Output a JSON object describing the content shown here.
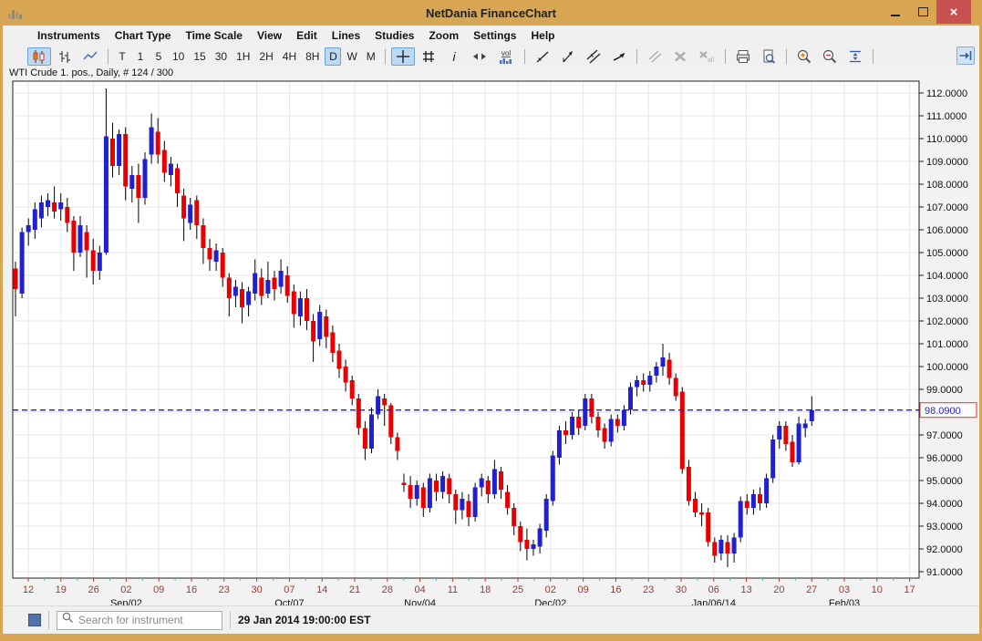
{
  "window": {
    "title": "NetDania FinanceChart",
    "icon": "chart-icon",
    "buttons": [
      {
        "name": "minimize"
      },
      {
        "name": "maximize"
      },
      {
        "name": "close",
        "glyph": "×"
      }
    ]
  },
  "menu": {
    "items": [
      {
        "label": "Instruments"
      },
      {
        "label": "Chart Type"
      },
      {
        "label": "Time Scale"
      },
      {
        "label": "View"
      },
      {
        "label": "Edit"
      },
      {
        "label": "Lines"
      },
      {
        "label": "Studies"
      },
      {
        "label": "Zoom"
      },
      {
        "label": "Settings"
      },
      {
        "label": "Help"
      }
    ]
  },
  "toolbar": {
    "items": [
      {
        "type": "icon",
        "name": "candlestick-chart",
        "selected": true
      },
      {
        "type": "icon",
        "name": "ohlc-bars"
      },
      {
        "type": "icon",
        "name": "line-chart"
      },
      {
        "type": "sep"
      },
      {
        "type": "text",
        "label": "T",
        "name": "timescale-tick"
      },
      {
        "type": "text",
        "label": "1",
        "name": "timescale-1m"
      },
      {
        "type": "text",
        "label": "5",
        "name": "timescale-5m"
      },
      {
        "type": "text",
        "label": "10",
        "name": "timescale-10m"
      },
      {
        "type": "text",
        "label": "15",
        "name": "timescale-15m"
      },
      {
        "type": "text",
        "label": "30",
        "name": "timescale-30m"
      },
      {
        "type": "text",
        "label": "1H",
        "name": "timescale-1h"
      },
      {
        "type": "text",
        "label": "2H",
        "name": "timescale-2h"
      },
      {
        "type": "text",
        "label": "4H",
        "name": "timescale-4h"
      },
      {
        "type": "text",
        "label": "8H",
        "name": "timescale-8h"
      },
      {
        "type": "text",
        "label": "D",
        "name": "timescale-daily",
        "selected": true
      },
      {
        "type": "text",
        "label": "W",
        "name": "timescale-weekly"
      },
      {
        "type": "text",
        "label": "M",
        "name": "timescale-monthly"
      },
      {
        "type": "sep"
      },
      {
        "type": "icon",
        "name": "crosshair",
        "selected": true
      },
      {
        "type": "icon",
        "name": "grid"
      },
      {
        "type": "icon",
        "name": "info"
      },
      {
        "type": "icon",
        "name": "scroll-horizontal"
      },
      {
        "type": "icon",
        "name": "volume"
      },
      {
        "type": "sep"
      },
      {
        "type": "icon",
        "name": "trendline"
      },
      {
        "type": "icon",
        "name": "trendline-angle"
      },
      {
        "type": "icon",
        "name": "parallel-lines"
      },
      {
        "type": "icon",
        "name": "draw-arrow"
      },
      {
        "type": "sep"
      },
      {
        "type": "icon",
        "name": "parallel-lines-disabled",
        "disabled": true
      },
      {
        "type": "icon",
        "name": "delete-line",
        "disabled": true
      },
      {
        "type": "icon",
        "name": "delete-all-lines",
        "disabled": true
      },
      {
        "type": "sep"
      },
      {
        "type": "icon",
        "name": "print"
      },
      {
        "type": "icon",
        "name": "print-preview"
      },
      {
        "type": "sep"
      },
      {
        "type": "icon",
        "name": "zoom-in"
      },
      {
        "type": "icon",
        "name": "zoom-out"
      },
      {
        "type": "icon",
        "name": "fit-vertical"
      },
      {
        "type": "sep"
      }
    ],
    "pin_button": {
      "name": "collapse-pin"
    }
  },
  "chart": {
    "label": "WTI Crude 1. pos., Daily, # 124 / 300",
    "price_line": {
      "value": "98.0900",
      "price": 98.09
    }
  },
  "chart_data": {
    "type": "candlestick",
    "title": "WTI Crude 1. pos., Daily",
    "instrument": "WTI Crude 1. pos.",
    "timeframe": "Daily",
    "visible_bars": 124,
    "total_bars": 300,
    "last_price": 98.09,
    "ylim": [
      90.7,
      112.5
    ],
    "y_ticks": [
      "112.0000",
      "111.0000",
      "110.0000",
      "109.0000",
      "108.0000",
      "107.0000",
      "106.0000",
      "105.0000",
      "104.0000",
      "103.0000",
      "102.0000",
      "101.0000",
      "100.0000",
      "99.0000",
      "98.0000",
      "97.0000",
      "96.0000",
      "95.0000",
      "94.0000",
      "93.0000",
      "92.0000",
      "91.0000"
    ],
    "x_week_labels": [
      "12",
      "19",
      "26",
      "02",
      "09",
      "16",
      "23",
      "30",
      "07",
      "14",
      "21",
      "28",
      "04",
      "11",
      "18",
      "25",
      "02",
      "09",
      "16",
      "23",
      "30",
      "06",
      "13",
      "20",
      "27",
      "03",
      "10",
      "17"
    ],
    "month_labels": [
      {
        "text": "Sep/02",
        "week": 3
      },
      {
        "text": "Oct/07",
        "week": 8
      },
      {
        "text": "Nov/04",
        "week": 12
      },
      {
        "text": "Dec/02",
        "week": 16
      },
      {
        "text": "Jan/06/14",
        "week": 21
      },
      {
        "text": "Feb/03",
        "week": 25
      }
    ],
    "candles": [
      [
        104.3,
        104.6,
        102.2,
        103.4
      ],
      [
        103.2,
        106.1,
        103.0,
        105.9
      ],
      [
        105.9,
        106.5,
        105.3,
        106.2
      ],
      [
        106.0,
        107.2,
        105.6,
        106.9
      ],
      [
        106.5,
        107.5,
        106.1,
        107.2
      ],
      [
        107.0,
        107.6,
        106.6,
        107.3
      ],
      [
        107.2,
        107.9,
        106.5,
        106.8
      ],
      [
        106.9,
        107.6,
        106.4,
        107.2
      ],
      [
        107.0,
        107.4,
        105.9,
        106.3
      ],
      [
        106.4,
        106.6,
        104.2,
        105.0
      ],
      [
        105.0,
        106.6,
        104.8,
        106.2
      ],
      [
        105.9,
        106.2,
        103.9,
        105.1
      ],
      [
        105.1,
        105.6,
        103.6,
        104.2
      ],
      [
        104.2,
        105.3,
        103.8,
        105.0
      ],
      [
        105.0,
        112.2,
        104.9,
        110.1
      ],
      [
        110.0,
        110.7,
        108.3,
        108.8
      ],
      [
        108.8,
        110.4,
        108.4,
        110.2
      ],
      [
        110.2,
        110.5,
        107.3,
        107.9
      ],
      [
        107.8,
        108.8,
        107.2,
        108.4
      ],
      [
        108.4,
        108.9,
        106.3,
        107.4
      ],
      [
        107.4,
        109.4,
        107.1,
        109.1
      ],
      [
        109.3,
        111.1,
        108.9,
        110.5
      ],
      [
        110.3,
        110.9,
        108.9,
        109.3
      ],
      [
        109.5,
        109.9,
        108.1,
        108.5
      ],
      [
        108.4,
        109.2,
        107.9,
        108.9
      ],
      [
        108.7,
        108.9,
        107.0,
        107.6
      ],
      [
        107.5,
        107.8,
        105.5,
        106.5
      ],
      [
        106.3,
        107.4,
        106.0,
        107.1
      ],
      [
        107.3,
        107.5,
        105.6,
        106.2
      ],
      [
        106.2,
        106.5,
        104.5,
        105.2
      ],
      [
        105.2,
        105.6,
        104.2,
        104.7
      ],
      [
        104.6,
        105.4,
        104.2,
        105.1
      ],
      [
        105.0,
        105.2,
        103.5,
        103.9
      ],
      [
        103.9,
        104.1,
        102.2,
        103.0
      ],
      [
        103.1,
        103.8,
        102.6,
        103.5
      ],
      [
        103.4,
        103.7,
        101.9,
        102.6
      ],
      [
        102.7,
        103.5,
        102.2,
        103.3
      ],
      [
        103.2,
        104.7,
        102.9,
        104.1
      ],
      [
        103.9,
        104.3,
        102.7,
        103.1
      ],
      [
        103.2,
        104.6,
        103.0,
        103.8
      ],
      [
        103.9,
        104.2,
        102.9,
        103.4
      ],
      [
        103.5,
        104.7,
        103.2,
        104.2
      ],
      [
        104.0,
        104.4,
        102.8,
        103.1
      ],
      [
        103.3,
        103.6,
        101.7,
        102.3
      ],
      [
        102.2,
        103.3,
        101.8,
        103.0
      ],
      [
        103.0,
        103.4,
        101.6,
        102.0
      ],
      [
        102.0,
        102.3,
        100.2,
        101.1
      ],
      [
        101.2,
        102.7,
        100.9,
        102.4
      ],
      [
        102.2,
        102.5,
        100.8,
        101.3
      ],
      [
        101.5,
        101.8,
        100.2,
        100.6
      ],
      [
        100.7,
        101.0,
        99.5,
        99.9
      ],
      [
        100.0,
        100.3,
        98.9,
        99.3
      ],
      [
        99.4,
        99.6,
        98.3,
        98.6
      ],
      [
        98.6,
        98.8,
        97.0,
        97.3
      ],
      [
        97.3,
        97.6,
        95.9,
        96.4
      ],
      [
        96.4,
        98.2,
        96.2,
        97.9
      ],
      [
        97.9,
        99.0,
        97.7,
        98.7
      ],
      [
        98.6,
        98.8,
        97.4,
        98.3
      ],
      [
        98.3,
        98.4,
        96.6,
        96.9
      ],
      [
        96.9,
        97.1,
        95.9,
        96.3
      ],
      [
        94.9,
        95.3,
        94.5,
        94.8
      ],
      [
        94.8,
        95.2,
        93.8,
        94.2
      ],
      [
        94.2,
        95.0,
        93.9,
        94.8
      ],
      [
        94.7,
        94.9,
        93.4,
        93.8
      ],
      [
        93.8,
        95.3,
        93.6,
        95.1
      ],
      [
        95.0,
        95.3,
        94.1,
        94.5
      ],
      [
        94.5,
        95.4,
        94.2,
        95.2
      ],
      [
        95.1,
        95.3,
        94.0,
        94.4
      ],
      [
        94.4,
        94.6,
        93.1,
        93.7
      ],
      [
        93.7,
        94.5,
        93.3,
        94.2
      ],
      [
        94.1,
        94.4,
        93.0,
        93.4
      ],
      [
        93.4,
        94.9,
        93.2,
        94.7
      ],
      [
        94.7,
        95.3,
        94.3,
        95.1
      ],
      [
        95.0,
        95.2,
        94.0,
        94.4
      ],
      [
        94.4,
        95.9,
        94.2,
        95.5
      ],
      [
        95.4,
        95.6,
        94.2,
        94.6
      ],
      [
        94.5,
        94.8,
        93.5,
        93.8
      ],
      [
        93.8,
        94.0,
        92.6,
        93.0
      ],
      [
        93.0,
        93.2,
        91.9,
        92.3
      ],
      [
        92.4,
        92.9,
        91.5,
        92.0
      ],
      [
        92.0,
        92.4,
        91.7,
        92.2
      ],
      [
        92.1,
        93.1,
        91.8,
        92.9
      ],
      [
        92.8,
        94.4,
        92.5,
        94.2
      ],
      [
        94.1,
        96.3,
        93.9,
        96.1
      ],
      [
        96.0,
        97.4,
        95.7,
        97.2
      ],
      [
        97.2,
        97.6,
        96.6,
        97.0
      ],
      [
        97.0,
        98.0,
        96.8,
        97.8
      ],
      [
        97.8,
        98.1,
        97.0,
        97.3
      ],
      [
        97.4,
        98.8,
        97.2,
        98.6
      ],
      [
        98.6,
        98.8,
        97.5,
        97.8
      ],
      [
        97.8,
        98.0,
        96.9,
        97.2
      ],
      [
        97.3,
        97.5,
        96.4,
        96.7
      ],
      [
        96.7,
        97.9,
        96.5,
        97.7
      ],
      [
        97.7,
        97.9,
        97.1,
        97.4
      ],
      [
        97.4,
        98.3,
        97.2,
        98.1
      ],
      [
        98.1,
        99.3,
        97.9,
        99.1
      ],
      [
        99.1,
        99.6,
        98.7,
        99.4
      ],
      [
        99.4,
        99.7,
        98.9,
        99.2
      ],
      [
        99.2,
        99.8,
        98.9,
        99.6
      ],
      [
        99.6,
        100.2,
        99.3,
        100.0
      ],
      [
        100.0,
        101.0,
        99.6,
        100.4
      ],
      [
        100.3,
        100.6,
        99.2,
        99.5
      ],
      [
        99.5,
        99.7,
        98.5,
        98.7
      ],
      [
        98.9,
        99.1,
        95.3,
        95.5
      ],
      [
        95.6,
        95.9,
        93.9,
        94.1
      ],
      [
        94.2,
        94.5,
        93.4,
        93.6
      ],
      [
        93.6,
        94.0,
        93.0,
        93.5
      ],
      [
        93.6,
        93.8,
        92.1,
        92.3
      ],
      [
        92.3,
        92.5,
        91.4,
        91.7
      ],
      [
        91.8,
        92.6,
        91.5,
        92.4
      ],
      [
        92.3,
        92.6,
        91.2,
        91.8
      ],
      [
        91.8,
        92.7,
        91.4,
        92.5
      ],
      [
        92.5,
        94.3,
        92.3,
        94.1
      ],
      [
        94.1,
        94.4,
        93.5,
        93.8
      ],
      [
        93.8,
        94.6,
        93.5,
        94.4
      ],
      [
        94.4,
        94.7,
        93.7,
        94.0
      ],
      [
        94.0,
        95.3,
        93.8,
        95.1
      ],
      [
        95.1,
        97.0,
        94.9,
        96.8
      ],
      [
        96.8,
        97.6,
        96.4,
        97.4
      ],
      [
        97.4,
        97.6,
        96.3,
        96.6
      ],
      [
        96.7,
        97.0,
        95.6,
        95.8
      ],
      [
        95.8,
        97.8,
        95.7,
        97.5
      ],
      [
        97.3,
        97.7,
        96.9,
        97.5
      ],
      [
        97.6,
        98.7,
        97.4,
        98.09
      ]
    ]
  },
  "statusbar": {
    "connection_icon": "connection-status-square",
    "search_placeholder": "Search for instrument",
    "search_icon": "search-icon",
    "timestamp": "29 Jan 2014 19:00:00 EST"
  },
  "colors": {
    "titlebar": "#D8A652",
    "close_button": "#C75050",
    "toolbar_selected_bg": "#BBD9F2",
    "toolbar_selected_border": "#6DA3D4",
    "candle_up": "#2020D0",
    "candle_down": "#E80000",
    "wick": "#000000",
    "gridline": "#E6E6E6",
    "dashed_price_line": "#0000FF",
    "price_tag_border": "#E03131",
    "price_tag_text": "#2222CC",
    "date_tick_label": "#9C3A31",
    "week_tick": "#C0392B",
    "minor_tick": "#5FB8B8"
  }
}
